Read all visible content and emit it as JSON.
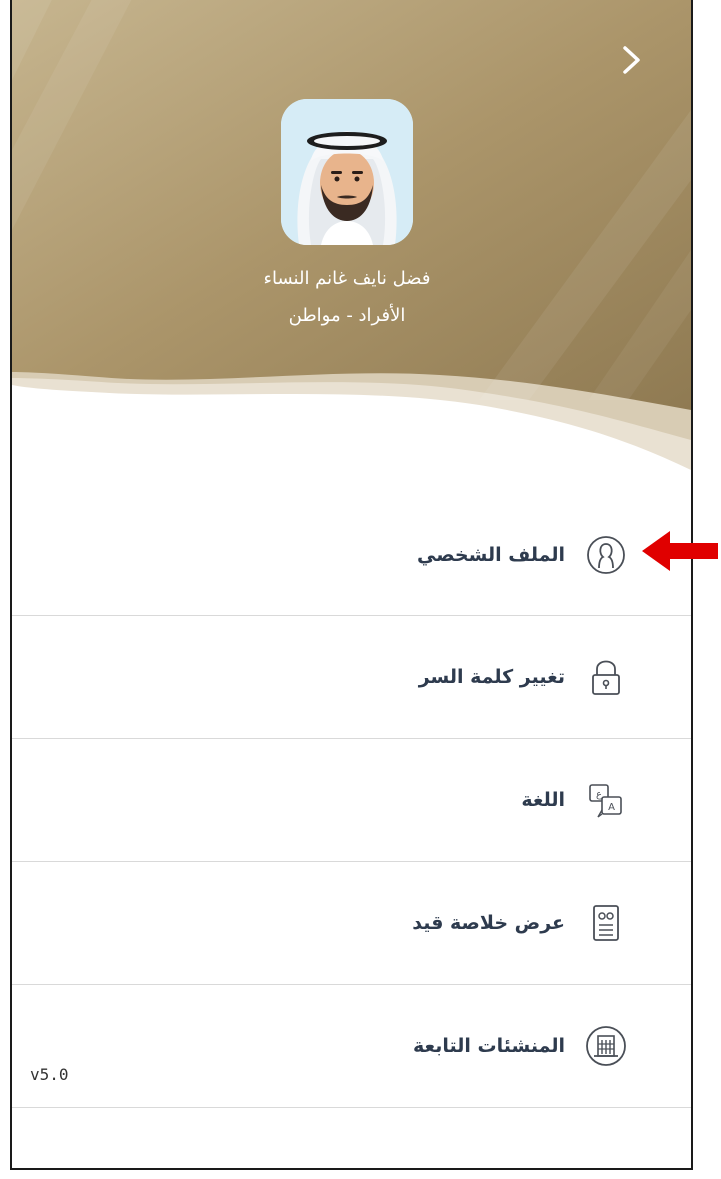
{
  "user": {
    "name": "فضل نايف غانم النساء",
    "role": "الأفراد - مواطن"
  },
  "icons": {
    "back": "chevron-right-icon",
    "profile": "user-circle-icon",
    "password": "lock-icon",
    "language": "translate-icon",
    "record": "id-card-icon",
    "facilities": "building-icon",
    "pointer": "red-arrow-icon"
  },
  "menu": {
    "items": [
      {
        "label": "الملف الشخصي"
      },
      {
        "label": "تغيير كلمة السر"
      },
      {
        "label": "اللغة"
      },
      {
        "label": "عرض خلاصة قيد"
      },
      {
        "label": "المنشئات التابعة"
      }
    ]
  },
  "app": {
    "version": "v5.0"
  },
  "colors": {
    "hero_gold": "#a48e64",
    "hero_gold_light": "#c8b894",
    "text_dark": "#2e3b4e",
    "divider": "#d9d9d9",
    "accent_arrow": "#e00000"
  }
}
